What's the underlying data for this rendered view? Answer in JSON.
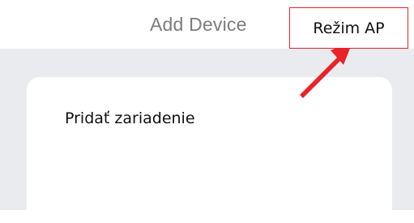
{
  "header": {
    "title": "Add Device"
  },
  "card": {
    "label": "Pridať zariadenie"
  },
  "callout": {
    "text": "Režim AP"
  },
  "colors": {
    "header_title": "#7d7d7d",
    "background": "#e9ebee",
    "card": "#ffffff",
    "callout_border": "#e8232a",
    "arrow": "#e8232a"
  },
  "icons": {
    "arrow": "red-pointer-arrow-icon"
  }
}
